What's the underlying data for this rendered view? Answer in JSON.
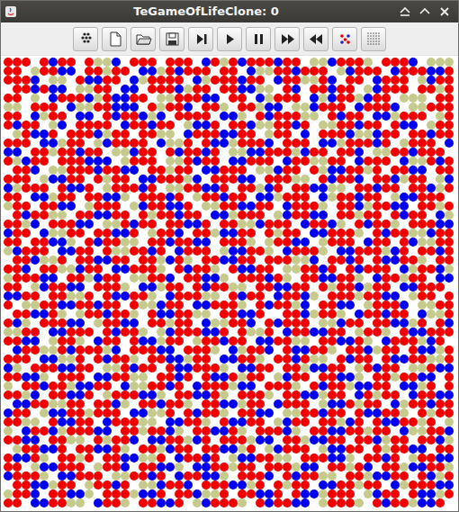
{
  "window": {
    "title": "TeGameOfLifeClone: 0"
  },
  "grid": {
    "palette": {
      "r": "#f20000",
      "b": "#0000f0",
      "k": "#c6cb8d"
    },
    "rows": [
      "rrr.rbrr.rkkb.rrr.rrr.brkrbrrrbrr.kkbrrrk.rrrb.kkk",
      "rr.krrbb.rrkrr.bbkrbrrr.rr.bkkrrbrrr.kbrrr.brrrbbr",
      "rrrb.kk.rbbrr.bkrrrr.bkrrrbrr.brrkkrb.rr.brrr.kbrr",
      ".rrbrbb.kkrr.bb.rrrbkrr.rrbbkk.rb.rrbrr.kbrrr.rrkr",
      "rr.k.brrrbkrbbrr.kkrrrbb.rr.bkrrr.bkbrrkbrr.kkk.rr",
      "kk.rrr.bkkrrbbb.rkrrb.rrk.rrkbb.kkbrrr.brrrb.kkrrr",
      "rr.bkrr.bb.rbrrbkb.rrrr.bbk.rbrrrkk.rbrr.bbkrrr.kr",
      "rbrr.kb.rrrr.brrbrr.kbbr.rrbkkrrbr.kkrrbrr.rbb.krr",
      ".krbbr.rrrbkrr.rrkk.brrrbbrr.krr.b.rrrbkkbrr.rrbrr",
      "rrr.bbkrr.kbrrrr.bkkr.rbbkrrrb.rrr.bbkrrrbr.krrr.b",
      "bb.rrkrrbrr.kkbrr.rbrrbr.kkbbrrrkbrr.rrb.kkrrbrrr.",
      "rkbrr.rrrbbb.krrr.kkrbrr.bbrrr.brrkkrr.brrr.bkkrbr",
      ".rrb.kkrrrbrrbb.rrkrr.bbrrr.kkbrr.rkbbrrkr.rrbb.rr",
      "rrr.kbbrr.rkrr.bbrrrkb.rrrbb.rrrkk.rbrrb.rrbkrr.kb",
      "bkrrr.rbbr.krrrbr.kkrrbbr.rrkbr.rrbbkk.rrbrr.rrbkr",
      "rr.bbkrr.rrbbk.rrrbr.krrbrr.bbkrrr.bkrrbrr.kbbrrr.",
      "krr.rrbb.krrr.kbrrbbr.kkrrbbrr.brrrk.rrbkrrbb.rrkr",
      ".rbrrkk.rrbbrr.rkrrbrr.bbkrrr.kbrrbb.rrkrr.rbrr.bk",
      "rrkb.rrrbb.kkrbrr.rrbbr.rrkkbrrr.brrbk.rbrrk.rrrbb",
      "brr.bkkrr.rrbbr.krrb.rrkbbrr.rkrr.bbrrrk.rbrrkkbrr",
      "rr.rrbbk.rbrrkk.rrbrrbb.rrrk.krrbb.krrr.brr.rbkkrr",
      "kbrrr.bbrr.rkkrrbr.brrr.kbbrrk.brrrk.bbrrrkbr.rrbr",
      ".rrbkkr.rrbbrr.rrkbrk.rrbbrr.rrrkkb.rrbr.rbbrrk.rr",
      "rrb.rrkkbrr.bbrrrk.rbrrk.rbbrr.kkrrbr.rbrrr.bkrrbk",
      "krrrbb.rrkbrr.kkrrb.rrbbk.rrrbrk.rrbbrrk.brrkrr.bb",
      "rr.kbrrbb.rrrk.bbkrr.rbrrkk.rrbbrr.rkrrbkrr.bbrrr.",
      "bbrr.rrkkr.rbbrrk.brrrkk.rbrr.brrbk.rrrkrrbb.krr.r",
      "r.kkrrbbrrbrr.rkkbrr.bbrrrk.rbrrkb.rrbb.krrrb.kkrr",
      ".rrbbrk.krrbrrk.rbbrrkk.rrbbr..rrbkrrk.brrbrr.bkkr",
      "rbk.rrrbb.krrbb.rrkrr.bkkrrb.rbrrr.kkbrr.rrbbkr.rb",
      "kkrr.bbrrr.rbrrk.kbrrrbbr.rkkr.brrbbrr.krrk.rbbrrr",
      "rrbb.krrk.brr.rbbkrr.krrbrr.bbrrkk.rrbbrk.brrrkbr.",
      ".brrkkrbrrrkb.rrrbb.rrrk.bkrrb.rbbrrk.rrbkrr.rbbkr",
      "rrr.bbkkr.rbrrk.rrbbkrr.bbrrk.rrbrkk.rbrr.rbbrrkkr",
      "bk.rrrbbrr.kkrbrr.rbbrrrk.bbrr.rrkbbrr.krbrr.kkrbb",
      "rrbbk.rrr.bbrrkk.rrbr.rbbrkrr.kbrr.rrbbk.rrkrrbb.r",
      "k.rrbrrkbbrr.bkkrrbr.brrrkbb.rrrk.rbrrkbbrr.bbkr.r",
      "rrkb.rrbbr.krrrbbk.rrbbrk.rrrk.rrbbkrr.brkrr.brrbb",
      ".bbrrkkrr.rrbk.rrbrrk.rrbbkrr.brrr.kbbrkrr.bkrrbrr",
      "brr.kbbrrkrrr.bbkkr.rbrrk.rrbb.kkrrbrr.rbbrrk.rkrr",
      "rrkk.rbbrr.brrrkk.bbrrk.rbbrr.kbrr.rrkbr.rbbrrkr.k",
      "k.brrbkrrrbb.rrkrrbk.rrbbrk.rrrbk.rrbbrrkrr.bkkrrb",
      "rrbb.rrkk.rkrrb.bbrrkbr.rrrkbb.rrkbbrr.rrbkrr.rrbk",
      ".krrbbr.rrbbrk.rrkbrr.rrbbkr.kbrrr.kbbrr.rkrrbb.rr",
      "rbbrk.rrkr.rrbbkkr.brrbr.kbbrrkk.rrrbbk.rrbr.krrbb",
      "rr.kbbrrr.krrb.rrbbk.bbrrkrr.rrrkbb.rrkrb.rrkbbrrk",
      "brrrk.bbrrr.kkrrbr.brrbbk.rrrb.rbrrkk.rrkbbrr.rbkr",
      ".rrbbkrr.krrbr.kkbrrb.rrrbbkr.rkrr.bbrrkrr.bkrrrbb",
      "krrb.rrbbk.rrrkbbr.rrbkkr.rrbbr.rbbkrrr.kbrr.rbbkr",
      "rr.bbrrkk.brrk.rrbbr.kbrrrk.rbrrbb.krrrk.rbrrkbbr."
    ]
  }
}
